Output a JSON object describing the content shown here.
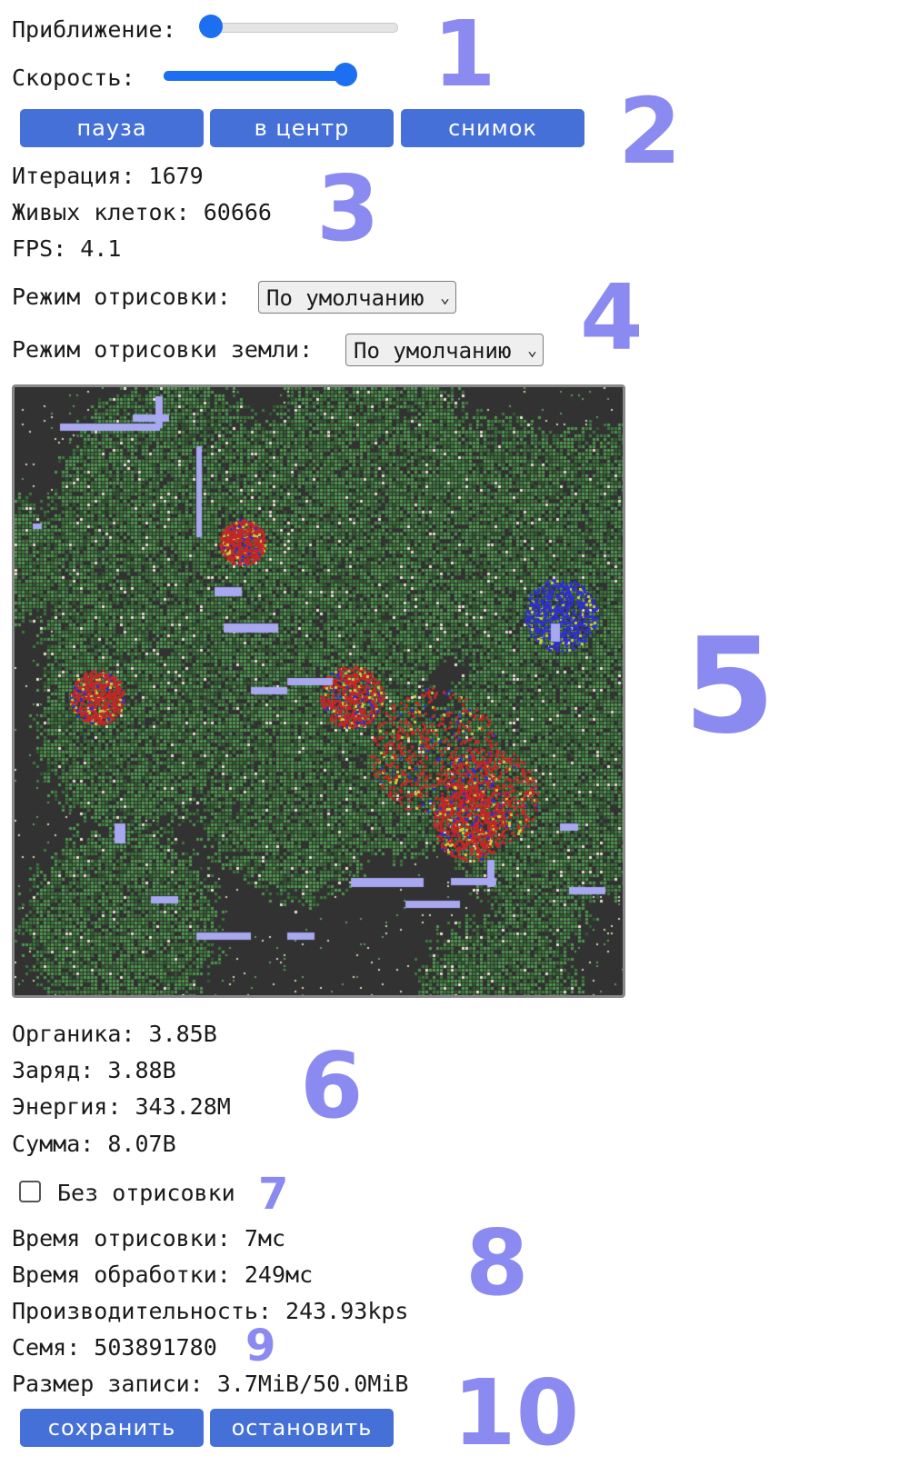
{
  "controls": {
    "zoom_label": "Приближение:",
    "zoom_value": 0.0,
    "speed_label": "Скорость:",
    "speed_value": 1.0,
    "buttons": {
      "pause": "пауза",
      "center": "в центр",
      "snapshot": "снимок"
    }
  },
  "stats": {
    "iteration": "Итерация: 1679",
    "alive_cells": "Живых клеток: 60666",
    "fps": "FPS: 4.1"
  },
  "render": {
    "mode_label": "Режим отрисовки:",
    "mode_value": "По умолчанию",
    "ground_mode_label": "Режим отрисовки земли:",
    "ground_mode_value": "По умолчанию"
  },
  "resources": {
    "organic": "Органика: 3.85B",
    "charge": "Заряд: 3.88B",
    "energy": "Энергия: 343.28M",
    "sum": "Сумма: 8.07B"
  },
  "no_render": {
    "label": "Без отрисовки",
    "checked": false
  },
  "timing": {
    "render_time": "Время отрисовки: 7мс",
    "process_time": "Время обработки: 249мс",
    "performance": "Производительность: 243.93kps",
    "seed": "Семя: 503891780",
    "record_size": "Размер записи: 3.7MiB/50.0MiB"
  },
  "record_buttons": {
    "save": "сохранить",
    "stop": "остановить"
  },
  "annotations": [
    "1",
    "2",
    "3",
    "4",
    "5",
    "6",
    "7",
    "8",
    "9",
    "10"
  ],
  "colors": {
    "accent": "#1c6ff0",
    "button": "#4470d8",
    "badge": "#8a8af0",
    "canvas_background": "#323232",
    "plant_green": "#4f9a4f",
    "water_lavender": "#a8a8f0",
    "cell_red": "#c02828",
    "cell_blue": "#3030c8"
  }
}
